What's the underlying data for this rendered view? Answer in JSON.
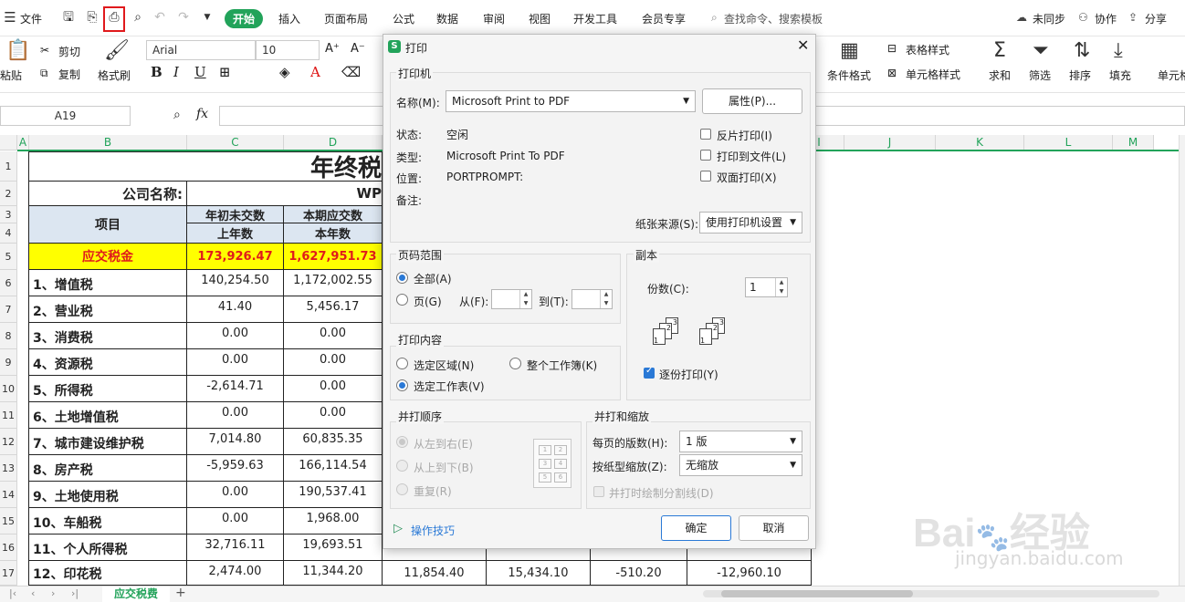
{
  "menu": {
    "file": "文件",
    "items": [
      "开始",
      "插入",
      "页面布局",
      "公式",
      "数据",
      "审阅",
      "视图",
      "开发工具",
      "会员专享"
    ],
    "search": "查找命令、搜索模板",
    "sync": "未同步",
    "collab": "协作",
    "share": "分享"
  },
  "ribbon": {
    "paste": "粘贴",
    "cut": "剪切",
    "copy": "复制",
    "format_painter": "格式刷",
    "font": "Arial",
    "size": "10",
    "cond_format": "条件格式",
    "table_style": "表格样式",
    "cell_style": "单元格样式",
    "sum": "求和",
    "filter": "筛选",
    "sort": "排序",
    "fill": "填充",
    "cell": "单元格",
    "bold": "B",
    "italic": "I",
    "underline": "U",
    "fx": "fx"
  },
  "formula": {
    "cell_ref": "A19"
  },
  "columns": [
    "A",
    "B",
    "C",
    "D",
    "I",
    "J",
    "K",
    "L",
    "M"
  ],
  "rows": [
    "1",
    "2",
    "3",
    "4",
    "5",
    "6",
    "7",
    "8",
    "9",
    "10",
    "11",
    "12",
    "13",
    "14",
    "15",
    "16",
    "17"
  ],
  "sheet": {
    "title": "年终税",
    "company_label": "公司名称:",
    "company_value": "WP",
    "header_item": "项目",
    "header_c1": "年初未交数",
    "header_c2": "上年数",
    "header_d1": "本期应交数",
    "header_d2": "本年数",
    "total_label": "应交税金",
    "total_c": "173,926.47",
    "total_d": "1,627,951.73",
    "data": [
      {
        "label": "1、增值税",
        "c": "140,254.50",
        "d": "1,172,002.55"
      },
      {
        "label": "2、营业税",
        "c": "41.40",
        "d": "5,456.17"
      },
      {
        "label": "3、消费税",
        "c": "0.00",
        "d": "0.00"
      },
      {
        "label": "4、资源税",
        "c": "0.00",
        "d": "0.00"
      },
      {
        "label": "5、所得税",
        "c": "-2,614.71",
        "d": "0.00"
      },
      {
        "label": "6、土地增值税",
        "c": "0.00",
        "d": "0.00"
      },
      {
        "label": "7、城市建设维护税",
        "c": "7,014.80",
        "d": "60,835.35"
      },
      {
        "label": "8、房产税",
        "c": "-5,959.63",
        "d": "166,114.54"
      },
      {
        "label": "9、土地使用税",
        "c": "0.00",
        "d": "190,537.41"
      },
      {
        "label": "10、车船税",
        "c": "0.00",
        "d": "1,968.00"
      },
      {
        "label": "11、个人所得税",
        "c": "32,716.11",
        "d": "19,693.51"
      },
      {
        "label": "12、印花税",
        "c": "2,474.00",
        "d": "11,344.20"
      }
    ],
    "row17_extra": [
      "11,854.40",
      "15,434.10",
      "-510.20",
      "-12,960.10"
    ],
    "tab": "应交税费"
  },
  "dialog": {
    "title": "打印",
    "printer_group": "打印机",
    "name_label": "名称(M):",
    "name_value": "Microsoft Print to PDF",
    "props_button": "属性(P)...",
    "status_label": "状态:",
    "status_value": "空闲",
    "type_label": "类型:",
    "type_value": "Microsoft Print To PDF",
    "where_label": "位置:",
    "where_value": "PORTPROMPT:",
    "comment_label": "备注:",
    "reverse": "反片打印(I)",
    "to_file": "打印到文件(L)",
    "duplex": "双面打印(X)",
    "source_label": "纸张来源(S):",
    "source_value": "使用打印机设置",
    "range_group": "页码范围",
    "all": "全部(A)",
    "pages": "页(G)",
    "from": "从(F):",
    "to": "到(T):",
    "copies_group": "副本",
    "copies_label": "份数(C):",
    "copies_value": "1",
    "collate": "逐份打印(Y)",
    "content_group": "打印内容",
    "selection": "选定区域(N)",
    "workbook": "整个工作簿(K)",
    "sheet": "选定工作表(V)",
    "order_group": "并打顺序",
    "ltr": "从左到右(E)",
    "ttb": "从上到下(B)",
    "repeat": "重复(R)",
    "scale_group": "并打和缩放",
    "per_page_label": "每页的版数(H):",
    "per_page_value": "1 版",
    "paper_scale_label": "按纸型缩放(Z):",
    "paper_scale_value": "无缩放",
    "draw_lines": "并打时绘制分割线(D)",
    "tips": "操作技巧",
    "ok": "确定",
    "cancel": "取消"
  },
  "watermark": {
    "brand": "Bai",
    "brand2": "经验",
    "url": "jingyan.baidu.com"
  }
}
